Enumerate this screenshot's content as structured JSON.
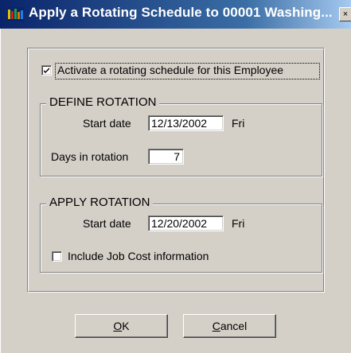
{
  "window": {
    "title": "Apply a Rotating Schedule to 00001 Washing...",
    "close_glyph": "×"
  },
  "activate": {
    "checked": true,
    "label": "Activate a rotating schedule for this Employee"
  },
  "define_rotation": {
    "group_title": "DEFINE ROTATION",
    "start_date_label": "Start date",
    "start_date_value": "12/13/2002",
    "start_weekday": "Fri",
    "days_label": "Days in rotation",
    "days_value": "7"
  },
  "apply_rotation": {
    "group_title": "APPLY ROTATION",
    "start_date_label": "Start date",
    "start_date_value": "12/20/2002",
    "start_weekday": "Fri",
    "job_cost_checked": false,
    "job_cost_label": "Include Job Cost information"
  },
  "buttons": {
    "ok_mnemonic": "O",
    "ok_rest": "K",
    "cancel_mnemonic": "C",
    "cancel_rest": "ancel"
  },
  "colors": {
    "title_gradient_start": "#0a246a",
    "title_gradient_end": "#a6caf0",
    "face": "#d4d0c8"
  }
}
